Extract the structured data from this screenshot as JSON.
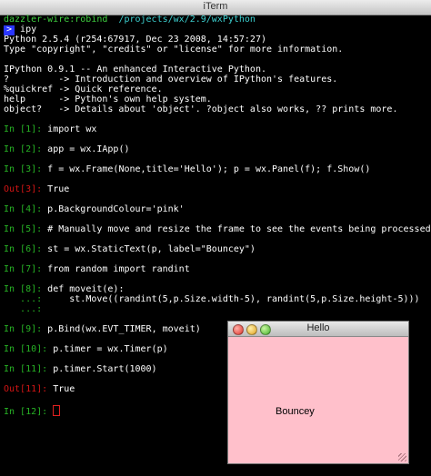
{
  "window": {
    "title": "iTerm"
  },
  "shell": {
    "user": "dazzler-wire:robind",
    "path": "/projects/wx/2.9/wxPython",
    "ps": ">",
    "cmd": " ipy"
  },
  "banner": [
    "Python 2.5.4 (r254:67917, Dec 23 2008, 14:57:27)",
    "Type \"copyright\", \"credits\" or \"license\" for more information.",
    "",
    "IPython 0.9.1 -- An enhanced Interactive Python.",
    "?         -> Introduction and overview of IPython's features.",
    "%quickref -> Quick reference.",
    "help      -> Python's own help system.",
    "object?   -> Details about 'object'. ?object also works, ?? prints more."
  ],
  "session": [
    {
      "kind": "in",
      "prompt": "In [1]:",
      "code": " import wx"
    },
    {
      "kind": "in",
      "prompt": "In [2]:",
      "code": " app = wx.IApp()"
    },
    {
      "kind": "in",
      "prompt": "In [3]:",
      "code": " f = wx.Frame(None,title='Hello'); p = wx.Panel(f); f.Show()"
    },
    {
      "kind": "out",
      "prompt": "Out[3]:",
      "code": " True"
    },
    {
      "kind": "in",
      "prompt": "In [4]:",
      "code": " p.BackgroundColour='pink'"
    },
    {
      "kind": "in",
      "prompt": "In [5]:",
      "code": " # Manually move and resize the frame to see the events being processed"
    },
    {
      "kind": "in",
      "prompt": "In [6]:",
      "code": " st = wx.StaticText(p, label=\"Bouncey\")"
    },
    {
      "kind": "in",
      "prompt": "In [7]:",
      "code": " from random import randint"
    },
    {
      "kind": "in",
      "prompt": "In [8]:",
      "code": " def moveit(e):"
    },
    {
      "kind": "cont",
      "prompt": "   ...:",
      "code": "     st.Move((randint(5,p.Size.width-5), randint(5,p.Size.height-5)))"
    },
    {
      "kind": "cont",
      "prompt": "   ...:",
      "code": ""
    },
    {
      "kind": "in",
      "prompt": "In [9]:",
      "code": " p.Bind(wx.EVT_TIMER, moveit)"
    },
    {
      "kind": "in",
      "prompt": "In [10]:",
      "code": " p.timer = wx.Timer(p)"
    },
    {
      "kind": "in",
      "prompt": "In [11]:",
      "code": " p.timer.Start(1000)"
    },
    {
      "kind": "out",
      "prompt": "Out[11]:",
      "code": " True"
    },
    {
      "kind": "in",
      "prompt": "In [12]:",
      "code": " "
    }
  ],
  "hello": {
    "title": "Hello",
    "label": "Bouncey",
    "background": "#ffc0cb"
  },
  "colors": {
    "in_prompt": "#27b325",
    "out_prompt": "#d41515",
    "terminal_bg": "#000000"
  }
}
